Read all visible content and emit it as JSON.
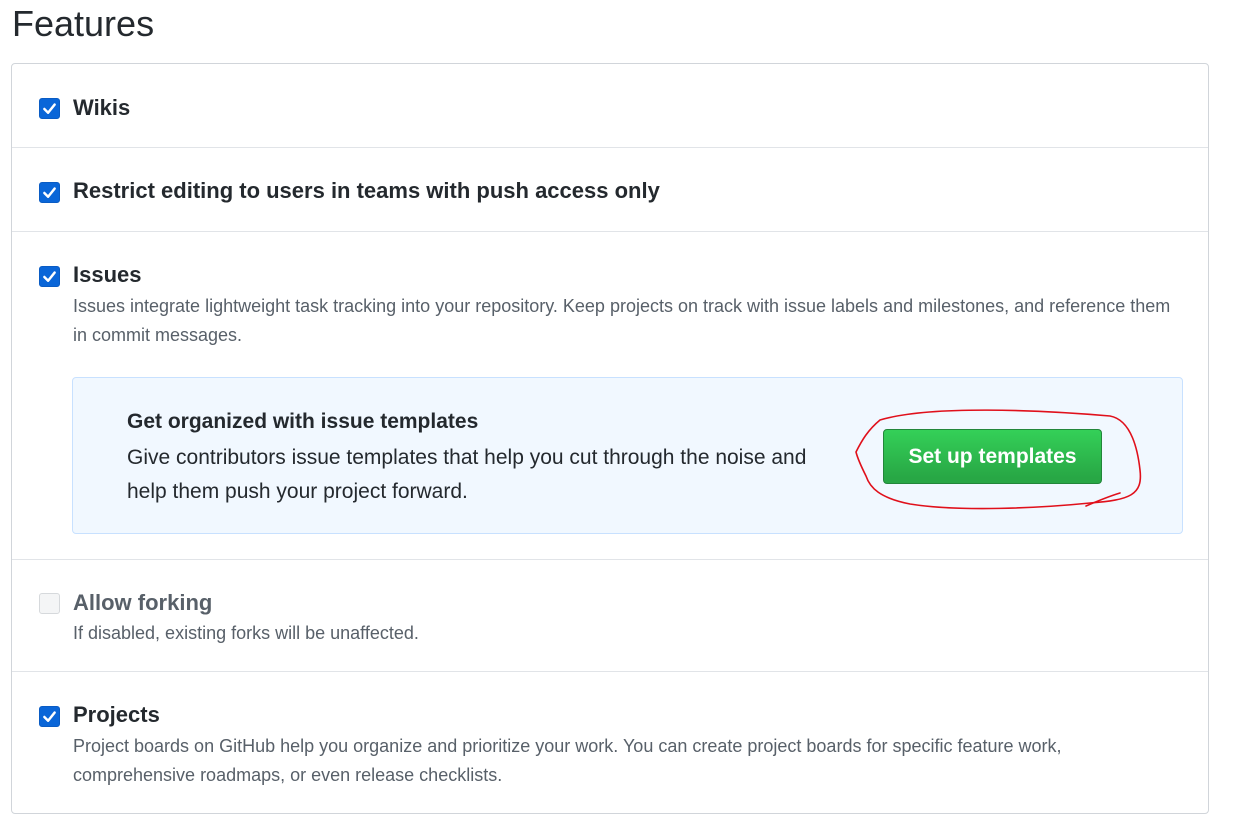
{
  "page": {
    "title": "Features"
  },
  "features": [
    {
      "label": "Wikis",
      "checked": true
    },
    {
      "label": "Restrict editing to users in teams with push access only",
      "checked": true
    },
    {
      "label": "Issues",
      "checked": true,
      "description": "Issues integrate lightweight task tracking into your repository. Keep projects on track with issue labels and milestones, and reference them in commit messages."
    },
    {
      "label": "Allow forking",
      "checked": false,
      "disabled": true,
      "description": "If disabled, existing forks will be unaffected."
    },
    {
      "label": "Projects",
      "checked": true,
      "description": "Project boards on GitHub help you organize and prioritize your work. You can create project boards for specific feature work, comprehensive roadmaps, or even release checklists."
    }
  ],
  "templates_callout": {
    "title": "Get organized with issue templates",
    "body": "Give contributors issue templates that help you cut through the noise and help them push your project forward.",
    "button_label": "Set up templates"
  },
  "colors": {
    "checkbox_checked": "#0a66d8",
    "button_green": "#2ea44f",
    "annotation_red": "#e0101b",
    "callout_bg": "#f1f8ff"
  }
}
